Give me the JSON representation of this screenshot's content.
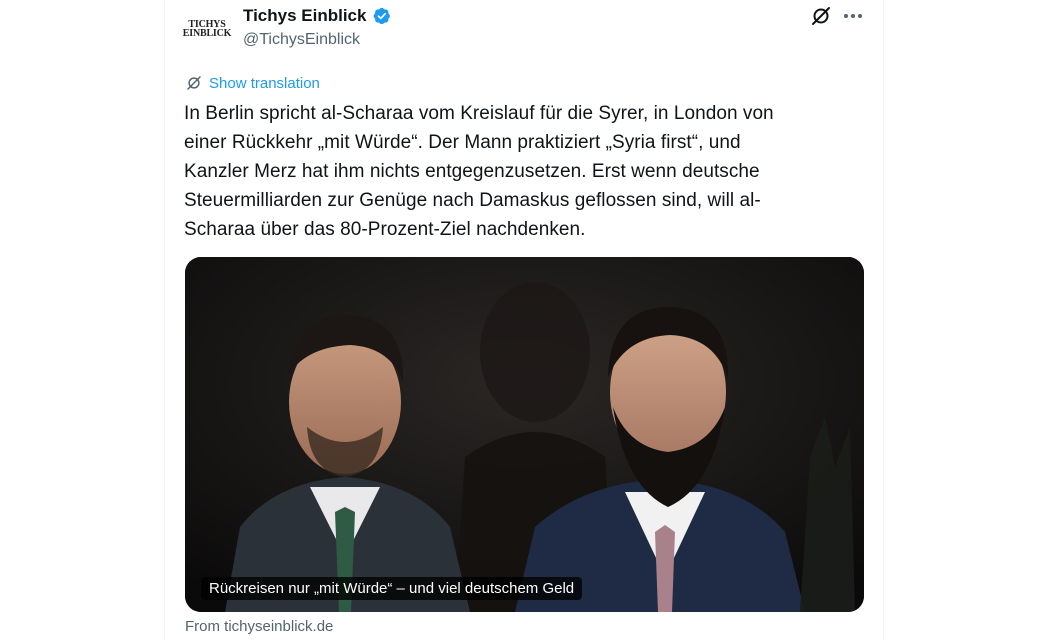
{
  "author": {
    "name": "Tichys Einblick",
    "handle": "@TichysEinblick",
    "avatar_line1": "TICHYS",
    "avatar_line2": "EINBLICK",
    "verified_color": "#1d9bf0"
  },
  "actions": {
    "grok_icon": "grok-icon",
    "more_icon": "more-icon"
  },
  "translation": {
    "label": "Show translation"
  },
  "tweet": {
    "text": "In Berlin spricht al-Scharaa vom Kreislauf für die Syrer, in London von\neiner Rückkehr „mit Würde“. Der Mann praktiziert „Syria first“, und\nKanzler Merz hat ihm nichts entgegenzusetzen. Erst wenn deutsche\nSteuermilliarden zur Genüge nach Damaskus geflossen sind, will al-\nScharaa über das 80-Prozent-Ziel nachdenken."
  },
  "card": {
    "caption": "Rückreisen nur „mit Würde“ – und viel deutschem Geld",
    "source": "From tichyseinblick.de"
  },
  "colors": {
    "accent": "#1d9bf0",
    "secondary_text": "#536471",
    "primary_text": "#0f1419"
  }
}
